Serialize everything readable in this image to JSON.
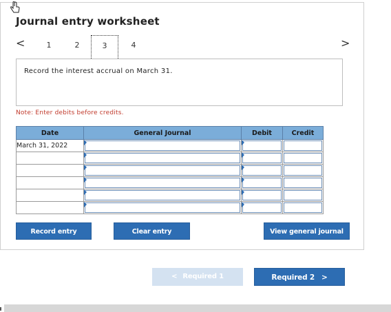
{
  "title": "Journal entry worksheet",
  "nav": {
    "prev": "<",
    "next": ">",
    "tabs": [
      "1",
      "2",
      "3",
      "4"
    ],
    "active_tab": "3"
  },
  "instruction": "Record the interest accrual on March 31.",
  "note": "Note: Enter debits before credits.",
  "table": {
    "headers": [
      "Date",
      "General Journal",
      "Debit",
      "Credit"
    ],
    "rows": [
      {
        "date": "March 31, 2022",
        "journal": "",
        "debit": "",
        "credit": ""
      },
      {
        "date": "",
        "journal": "",
        "debit": "",
        "credit": ""
      },
      {
        "date": "",
        "journal": "",
        "debit": "",
        "credit": ""
      },
      {
        "date": "",
        "journal": "",
        "debit": "",
        "credit": ""
      },
      {
        "date": "",
        "journal": "",
        "debit": "",
        "credit": ""
      },
      {
        "date": "",
        "journal": "",
        "debit": "",
        "credit": ""
      }
    ]
  },
  "buttons": {
    "record": "Record entry",
    "clear": "Clear entry",
    "view": "View general journal"
  },
  "pager": {
    "prev_label": "Required 1",
    "prev_icon": "<",
    "next_label": "Required 2",
    "next_icon": ">"
  },
  "colors": {
    "accent": "#2d6db3",
    "header": "#7badd9",
    "note": "#c0392b",
    "disabled": "#d4e2f1"
  },
  "icons": [
    "hand-pointer-icon",
    "chevron-left-icon",
    "chevron-right-icon"
  ]
}
